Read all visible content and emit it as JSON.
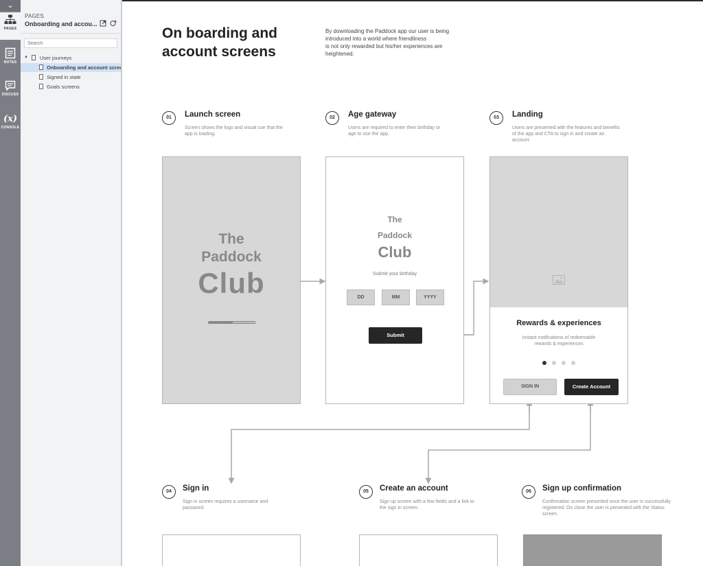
{
  "rail": {
    "items": [
      {
        "label": "PAGES",
        "icon": "sitemap-icon"
      },
      {
        "label": "NOTES",
        "icon": "notes-icon"
      },
      {
        "label": "DISCUSS",
        "icon": "discuss-icon"
      },
      {
        "label": "CONSOLE",
        "icon": "variable-icon",
        "glyph": "(x)"
      }
    ]
  },
  "panel": {
    "label": "PAGES",
    "title": "Onboarding and accou...",
    "search_placeholder": "Search",
    "tree": {
      "folder": "User journeys",
      "pages": [
        "Onboarding and account scree",
        "Signed in state",
        "Goals screens"
      ]
    }
  },
  "canvas": {
    "title_line1": "On boarding and",
    "title_line2": "account screens",
    "intro_line1": "By downloading the Paddock app our user is being",
    "intro_line2": "introduced into a world where friendliness",
    "intro_line3": "is not only rewarded but his/her experiences are",
    "intro_line4": "heightened.",
    "steps": [
      {
        "num": "01",
        "title": "Launch screen",
        "desc": "Screen shows the logo and visual cue that the app is loading."
      },
      {
        "num": "02",
        "title": "Age gateway",
        "desc": "Users are required to enter their birthday or age to use the app."
      },
      {
        "num": "03",
        "title": "Landing",
        "desc": "Users are presented with the features and benefits of the app and CTA to sign in and create an account."
      },
      {
        "num": "04",
        "title": "Sign in",
        "desc": "Sign in screen requires a username and password."
      },
      {
        "num": "05",
        "title": "Create an account",
        "desc": "Sign up screen with a few fields and a link to the sign in screen."
      },
      {
        "num": "06",
        "title": "Sign up confirmation",
        "desc": "Confirmation screen presented once the user is successfully registered. On close the user is presented with the Status screen."
      }
    ],
    "logo": {
      "line1": "The",
      "line2": "Paddock",
      "line3": "Club"
    },
    "age_gateway": {
      "prompt": "Submit your birthday",
      "day": "DD",
      "month": "MM",
      "year": "YYYY",
      "submit": "Submit"
    },
    "landing": {
      "heading": "Rewards & experiences",
      "subtext_line1": "Instant notifications of redeemable",
      "subtext_line2": "rewards & experiences",
      "sign_in": "SIGN IN",
      "create_account": "Create Account",
      "carousel_dots": 4,
      "active_dot": 1
    }
  },
  "colors": {
    "rail": "#7b7f85",
    "panel": "#f2f3f5",
    "selected_row": "#cfe2f5",
    "wire_gray": "#d7d7d7",
    "dark_button": "#262626",
    "connector": "#a9a9a9"
  }
}
